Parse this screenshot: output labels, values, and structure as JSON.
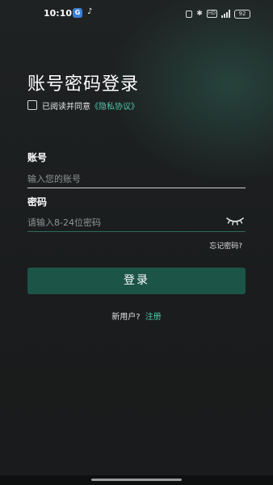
{
  "status_bar": {
    "time": "10:10",
    "app_icon_letter": "G",
    "battery": "92"
  },
  "title": "账号密码登录",
  "agreement": {
    "prefix": "已阅读并同意",
    "link": "《隐私协议》"
  },
  "account": {
    "label": "账号",
    "placeholder": "输入您的账号",
    "value": ""
  },
  "password": {
    "label": "密码",
    "placeholder": "请输入8-24位密码",
    "value": ""
  },
  "forgot_password": "忘记密码?",
  "login_button": "登录",
  "register": {
    "prompt": "新用户?",
    "link": "注册"
  },
  "colors": {
    "accent": "#53c7ab",
    "button": "#1d5448",
    "background": "#1b1d1e"
  }
}
